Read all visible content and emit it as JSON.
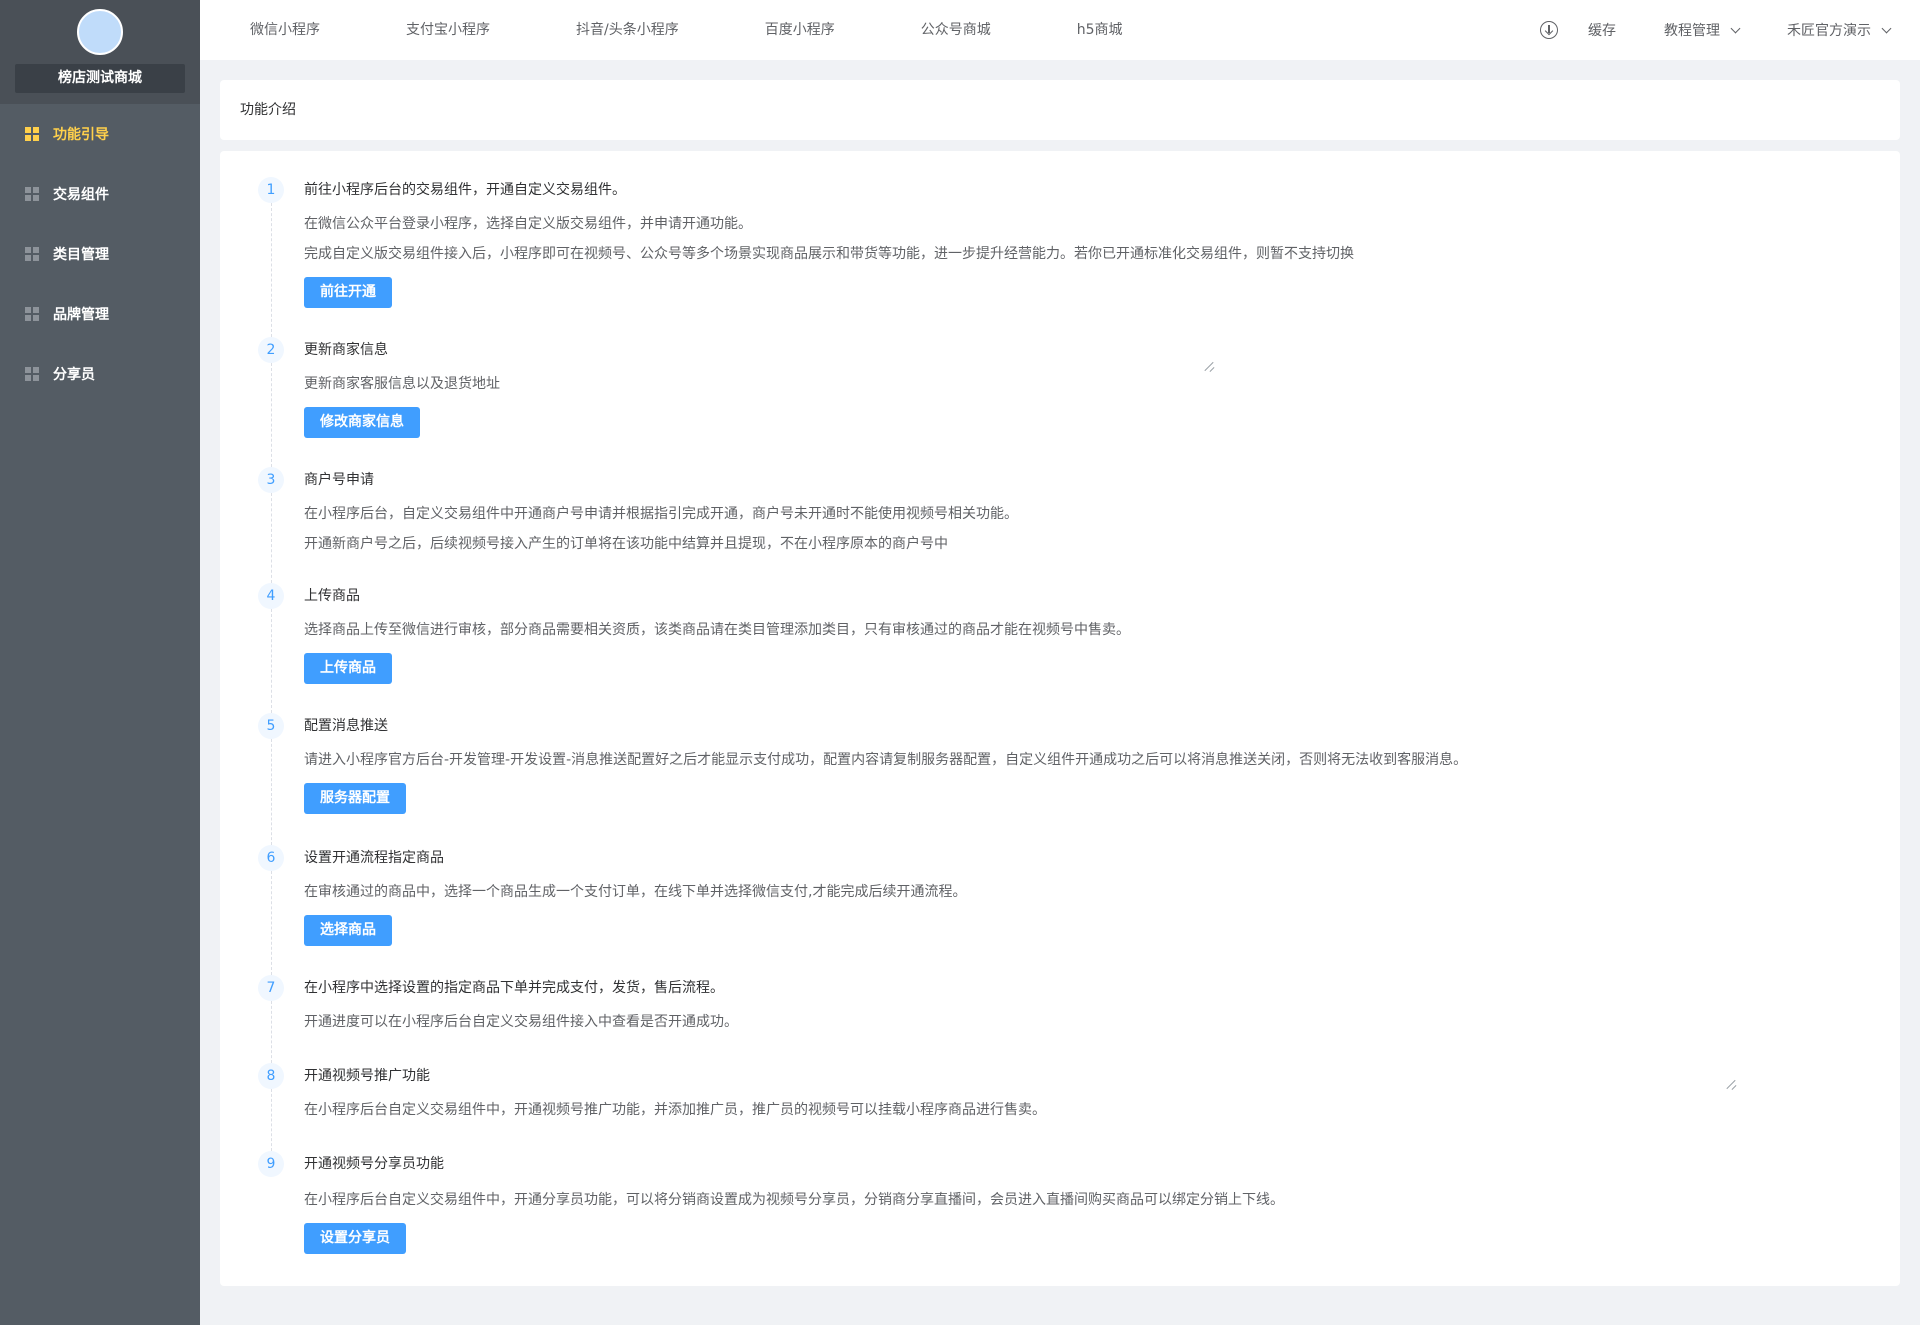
{
  "sidebar": {
    "shop_name": "榜店测试商城",
    "items": [
      {
        "label": "功能引导",
        "icon": "grid-icon",
        "active": true
      },
      {
        "label": "交易组件",
        "icon": "grid-icon",
        "active": false
      },
      {
        "label": "类目管理",
        "icon": "grid-icon",
        "active": false
      },
      {
        "label": "品牌管理",
        "icon": "grid-icon",
        "active": false
      },
      {
        "label": "分享员",
        "icon": "grid-icon",
        "active": false
      }
    ]
  },
  "topbar": {
    "nav": [
      "微信小程序",
      "支付宝小程序",
      "抖音/头条小程序",
      "百度小程序",
      "公众号商城",
      "h5商城"
    ],
    "cache": "缓存",
    "tutorial": "教程管理",
    "user": "禾匠官方演示"
  },
  "header": {
    "title": "功能介绍"
  },
  "steps": [
    {
      "num": "1",
      "title": "前往小程序后台的交易组件，开通自定义交易组件。",
      "desc": [
        "在微信公众平台登录小程序，选择自定义版交易组件，并申请开通功能。",
        "完成自定义版交易组件接入后，小程序即可在视频号、公众号等多个场景实现商品展示和带货等功能，进一步提升经营能力。若你已开通标准化交易组件，则暂不支持切换"
      ],
      "button": "前往开通"
    },
    {
      "num": "2",
      "title": "更新商家信息",
      "desc": [
        "更新商家客服信息以及退货地址"
      ],
      "button": "修改商家信息"
    },
    {
      "num": "3",
      "title": "商户号申请",
      "desc": [
        "在小程序后台，自定义交易组件中开通商户号申请并根据指引完成开通，商户号未开通时不能使用视频号相关功能。",
        "开通新商户号之后，后续视频号接入产生的订单将在该功能中结算并且提现，不在小程序原本的商户号中"
      ]
    },
    {
      "num": "4",
      "title": "上传商品",
      "desc": [
        "选择商品上传至微信进行审核，部分商品需要相关资质，该类商品请在类目管理添加类目，只有审核通过的商品才能在视频号中售卖。"
      ],
      "button": "上传商品"
    },
    {
      "num": "5",
      "title": " 配置消息推送",
      "desc": [
        "请进入小程序官方后台-开发管理-开发设置-消息推送配置好之后才能显示支付成功，配置内容请复制服务器配置，自定义组件开通成功之后可以将消息推送关闭，否则将无法收到客服消息。"
      ],
      "button": "服务器配置"
    },
    {
      "num": "6",
      "title": "设置开通流程指定商品",
      "desc": [
        "在审核通过的商品中，选择一个商品生成一个支付订单，在线下单并选择微信支付,才能完成后续开通流程。"
      ],
      "button": "选择商品"
    },
    {
      "num": "7",
      "title": "在小程序中选择设置的指定商品下单并完成支付，发货，售后流程。",
      "desc": [
        "开通进度可以在小程序后台自定义交易组件接入中查看是否开通成功。"
      ]
    },
    {
      "num": "8",
      "title": "开通视频号推广功能",
      "desc": [
        "在小程序后台自定义交易组件中，开通视频号推广功能，并添加推广员，推广员的视频号可以挂载小程序商品进行售卖。"
      ]
    },
    {
      "num": "9",
      "title": "开通视频号分享员功能",
      "desc": [
        "在小程序后台自定义交易组件中，开通分享员功能，可以将分销商设置成为视频号分享员，分销商分享直播间，会员进入直播间购买商品可以绑定分销上下线。"
      ],
      "button": "设置分享员"
    }
  ]
}
